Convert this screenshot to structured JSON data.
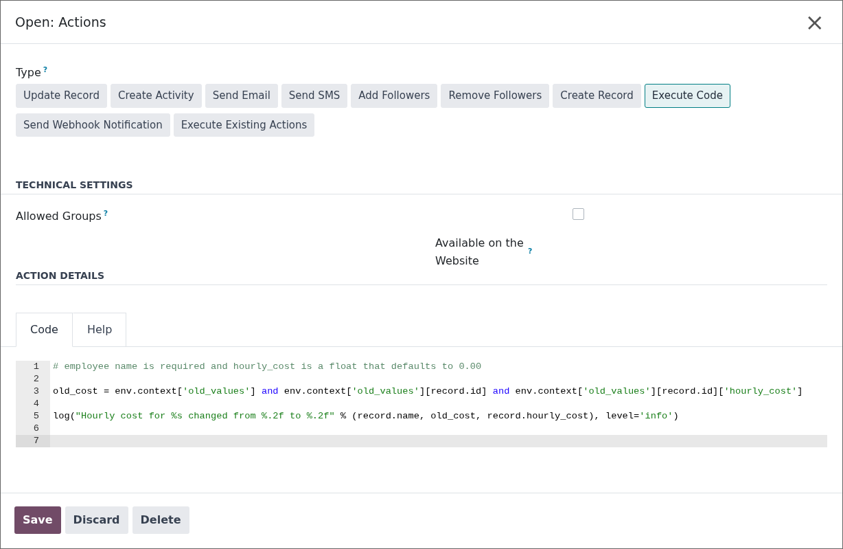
{
  "dialog": {
    "title": "Open: Actions",
    "close": "×"
  },
  "type_field": {
    "label": "Type",
    "help": "?",
    "options": [
      {
        "label": "Update Record",
        "selected": false
      },
      {
        "label": "Create Activity",
        "selected": false
      },
      {
        "label": "Send Email",
        "selected": false
      },
      {
        "label": "Send SMS",
        "selected": false
      },
      {
        "label": "Add Followers",
        "selected": false
      },
      {
        "label": "Remove Followers",
        "selected": false
      },
      {
        "label": "Create Record",
        "selected": false
      },
      {
        "label": "Execute Code",
        "selected": true
      },
      {
        "label": "Send Webhook Notification",
        "selected": false
      },
      {
        "label": "Execute Existing Actions",
        "selected": false
      }
    ]
  },
  "technical_settings": {
    "heading": "TECHNICAL SETTINGS",
    "allowed_groups": {
      "label": "Allowed Groups",
      "help": "?"
    },
    "available_on_website": {
      "label": "Available on the Website",
      "help": "?",
      "checked": false
    }
  },
  "action_details": {
    "heading": "ACTION DETAILS",
    "tabs": [
      {
        "label": "Code",
        "selected": true
      },
      {
        "label": "Help",
        "selected": false
      }
    ],
    "code_lines": [
      {
        "number": "1",
        "active": false,
        "tokens": [
          {
            "kind": "comment",
            "text": "# employee name is required and hourly_cost is a float that defaults to 0.00"
          }
        ]
      },
      {
        "number": "2",
        "active": false
      },
      {
        "number": "3",
        "active": false,
        "tokens": [
          {
            "kind": "plain",
            "text": "old_cost = env.context["
          },
          {
            "kind": "string",
            "text": "'old_values'"
          },
          {
            "kind": "plain",
            "text": "] "
          },
          {
            "kind": "keyword",
            "text": "and"
          },
          {
            "kind": "plain",
            "text": " env.context["
          },
          {
            "kind": "string",
            "text": "'old_values'"
          },
          {
            "kind": "plain",
            "text": "][record.id] "
          },
          {
            "kind": "keyword",
            "text": "and"
          },
          {
            "kind": "plain",
            "text": " env.context["
          },
          {
            "kind": "string",
            "text": "'old_values'"
          },
          {
            "kind": "plain",
            "text": "][record.id]["
          },
          {
            "kind": "string",
            "text": "'hourly_cost'"
          },
          {
            "kind": "plain",
            "text": "]"
          }
        ]
      },
      {
        "number": "4",
        "active": false
      },
      {
        "number": "5",
        "active": false,
        "tokens": [
          {
            "kind": "plain",
            "text": "log("
          },
          {
            "kind": "string",
            "text": "\"Hourly cost for %s changed from %.2f to %.2f\""
          },
          {
            "kind": "plain",
            "text": " % (record.name, old_cost, record.hourly_cost), level="
          },
          {
            "kind": "string",
            "text": "'info'"
          },
          {
            "kind": "plain",
            "text": ")"
          }
        ]
      },
      {
        "number": "6",
        "active": false
      },
      {
        "number": "7",
        "active": true
      }
    ]
  },
  "footer_buttons": [
    {
      "label": "Save",
      "kind": "primary"
    },
    {
      "label": "Discard",
      "kind": "secondary"
    },
    {
      "label": "Delete",
      "kind": "secondary"
    }
  ]
}
